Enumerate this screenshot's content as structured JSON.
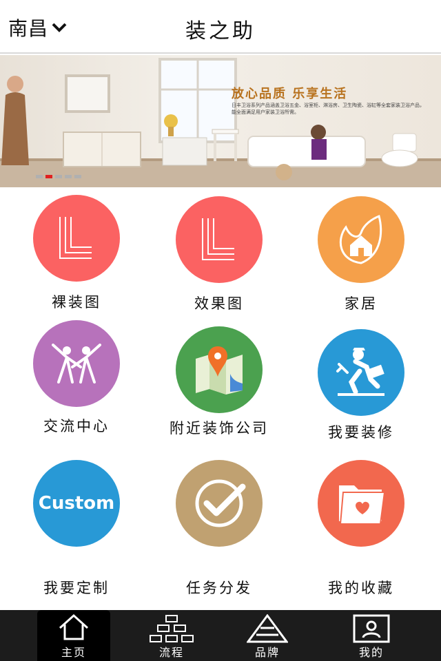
{
  "header": {
    "city": "南昌",
    "title": "装之助"
  },
  "banner": {
    "headline": "放心品质  乐享生活",
    "subtext": "日丰卫浴系列产品涵盖卫浴五金、浴室柜、淋浴房、卫生陶瓷、浴缸等全套家装卫浴产品，能全面满足用户家装卫浴所需。",
    "slide_count": 5,
    "active_slide": 2
  },
  "grid": [
    {
      "label": "裸装图",
      "icon": "l-lines-icon",
      "color": "#fb6262"
    },
    {
      "label": "效果图",
      "icon": "l-lines-icon",
      "color": "#fb6262"
    },
    {
      "label": "家居",
      "icon": "leaf-house-icon",
      "color": "#f5a04a"
    },
    {
      "label": "交流中心",
      "icon": "people-cheer-icon",
      "color": "#b772bb"
    },
    {
      "label": "附近装饰公司",
      "icon": "map-pin-icon",
      "color": "#4ba14f"
    },
    {
      "label": "我要装修",
      "icon": "worker-icon",
      "color": "#2899d6"
    },
    {
      "label": "我要定制",
      "icon": "custom-icon",
      "color": "#2899d6",
      "icon_text": "Custom"
    },
    {
      "label": "任务分发",
      "icon": "check-icon",
      "color": "#c0a171"
    },
    {
      "label": "我的收藏",
      "icon": "folder-heart-icon",
      "color": "#f2684e"
    }
  ],
  "nav": [
    {
      "label": "主页",
      "icon": "home-icon",
      "active": true
    },
    {
      "label": "流程",
      "icon": "flowchart-icon",
      "active": false
    },
    {
      "label": "品牌",
      "icon": "pyramid-icon",
      "active": false
    },
    {
      "label": "我的",
      "icon": "profile-icon",
      "active": false
    }
  ]
}
